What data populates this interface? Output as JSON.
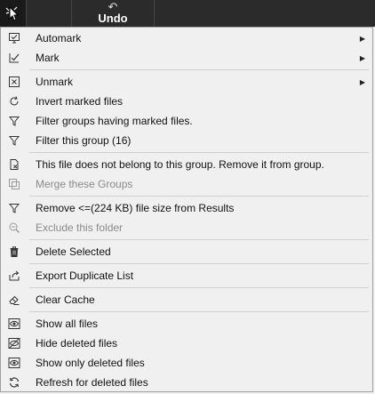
{
  "toolbar": {
    "undo_arrow": "↶",
    "undo_label": "Undo"
  },
  "menu": {
    "items": [
      {
        "label": "Automark",
        "icon": "automark-icon",
        "submenu": true,
        "enabled": true
      },
      {
        "label": "Mark",
        "icon": "checkbox-check-icon",
        "submenu": true,
        "enabled": true
      },
      {
        "label": "Unmark",
        "icon": "checkbox-x-icon",
        "submenu": true,
        "enabled": true
      },
      {
        "label": "Invert marked files",
        "icon": "refresh-icon",
        "submenu": false,
        "enabled": true
      },
      {
        "label": "Filter groups having marked files.",
        "icon": "filter-icon",
        "submenu": false,
        "enabled": true
      },
      {
        "label": "Filter this group (16)",
        "icon": "filter-icon",
        "submenu": false,
        "enabled": true
      },
      {
        "label": "This file does not belong to this group. Remove it from group.",
        "icon": "remove-file-icon",
        "submenu": false,
        "enabled": true
      },
      {
        "label": "Merge these Groups",
        "icon": "merge-icon",
        "submenu": false,
        "enabled": false
      },
      {
        "label": "Remove <=(224 KB) file size from Results",
        "icon": "filter-icon",
        "submenu": false,
        "enabled": true
      },
      {
        "label": "Exclude this folder",
        "icon": "zoom-icon",
        "submenu": false,
        "enabled": false
      },
      {
        "label": "Delete Selected",
        "icon": "trash-icon",
        "submenu": false,
        "enabled": true
      },
      {
        "label": "Export Duplicate List",
        "icon": "export-icon",
        "submenu": false,
        "enabled": true
      },
      {
        "label": "Clear Cache",
        "icon": "eraser-icon",
        "submenu": false,
        "enabled": true
      },
      {
        "label": "Show all files",
        "icon": "eye-icon",
        "submenu": false,
        "enabled": true
      },
      {
        "label": "Hide deleted files",
        "icon": "eye-slash-icon",
        "submenu": false,
        "enabled": true
      },
      {
        "label": "Show only deleted files",
        "icon": "eye-icon",
        "submenu": false,
        "enabled": true
      },
      {
        "label": "Refresh for deleted files",
        "icon": "refresh-icon",
        "submenu": false,
        "enabled": true
      }
    ],
    "submenu_arrow": "▶"
  }
}
